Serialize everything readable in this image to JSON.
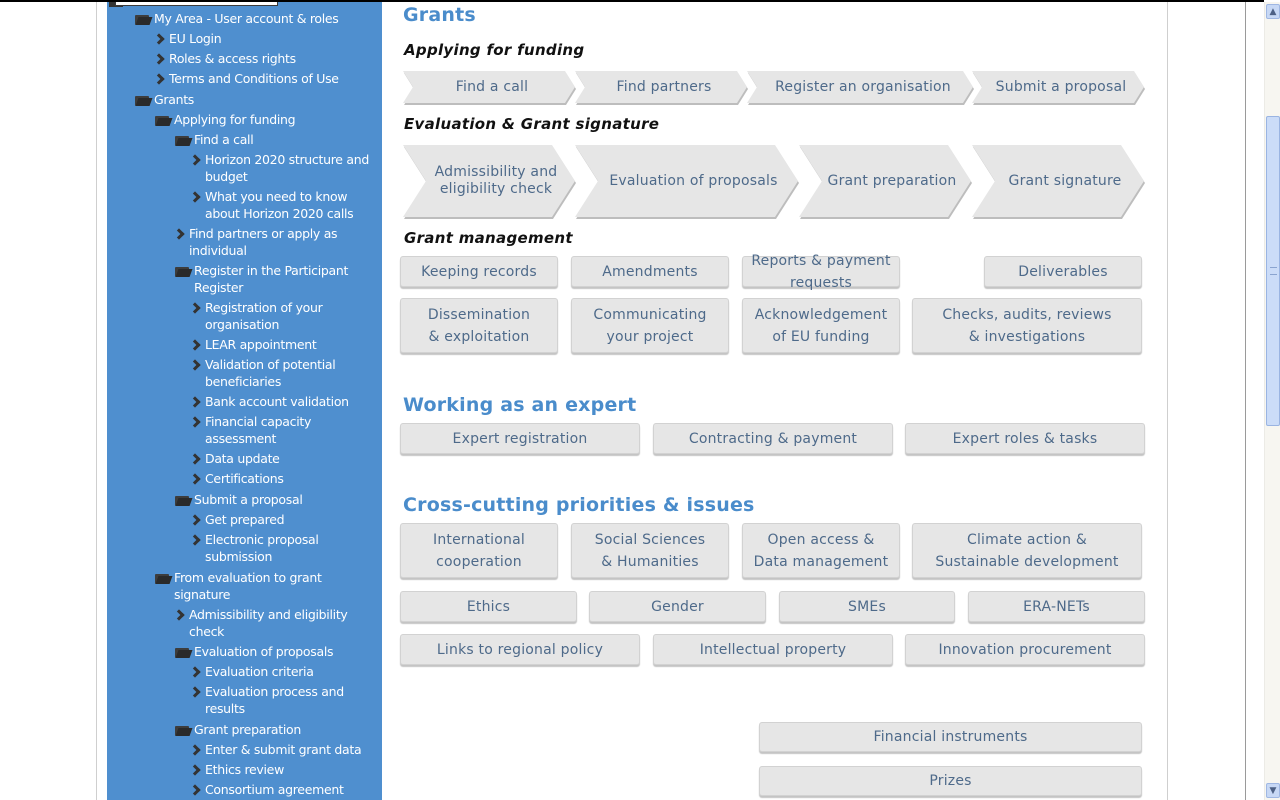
{
  "sidebar": {
    "items": [
      {
        "label": "My Area - User account & roles",
        "icon": "folder-open-icon",
        "level": 0
      },
      {
        "label": "EU Login",
        "icon": "chevron-right-icon",
        "level": 1
      },
      {
        "label": "Roles & access rights",
        "icon": "chevron-right-icon",
        "level": 1
      },
      {
        "label": "Terms and Conditions of Use",
        "icon": "chevron-right-icon",
        "level": 1
      },
      {
        "label": "Grants",
        "icon": "folder-open-icon",
        "level": 0
      },
      {
        "label": "Applying for funding",
        "icon": "folder-open-icon",
        "level": 1
      },
      {
        "label": "Find a call",
        "icon": "folder-open-icon",
        "level": 2
      },
      {
        "label": "Horizon 2020 structure and budget",
        "icon": "chevron-right-icon",
        "level": 3
      },
      {
        "label": "What you need to know about Horizon 2020 calls",
        "icon": "chevron-right-icon",
        "level": 3
      },
      {
        "label": "Find partners or apply as individual",
        "icon": "chevron-right-icon",
        "level": 2
      },
      {
        "label": "Register in the Participant Register",
        "icon": "folder-open-icon",
        "level": 2
      },
      {
        "label": "Registration of your organisation",
        "icon": "chevron-right-icon",
        "level": 3
      },
      {
        "label": "LEAR appointment",
        "icon": "chevron-right-icon",
        "level": 3
      },
      {
        "label": "Validation of potential beneficiaries",
        "icon": "chevron-right-icon",
        "level": 3
      },
      {
        "label": "Bank account validation",
        "icon": "chevron-right-icon",
        "level": 3
      },
      {
        "label": "Financial capacity assessment",
        "icon": "chevron-right-icon",
        "level": 3
      },
      {
        "label": "Data update",
        "icon": "chevron-right-icon",
        "level": 3
      },
      {
        "label": "Certifications",
        "icon": "chevron-right-icon",
        "level": 3
      },
      {
        "label": "Submit a proposal",
        "icon": "folder-open-icon",
        "level": 2
      },
      {
        "label": "Get prepared",
        "icon": "chevron-right-icon",
        "level": 3
      },
      {
        "label": "Electronic proposal submission",
        "icon": "chevron-right-icon",
        "level": 3
      },
      {
        "label": "From evaluation to grant signature",
        "icon": "folder-open-icon",
        "level": 1
      },
      {
        "label": "Admissibility and eligibility check",
        "icon": "chevron-right-icon",
        "level": 2
      },
      {
        "label": "Evaluation of proposals",
        "icon": "folder-open-icon",
        "level": 2
      },
      {
        "label": "Evaluation criteria",
        "icon": "chevron-right-icon",
        "level": 3
      },
      {
        "label": "Evaluation process and results",
        "icon": "chevron-right-icon",
        "level": 3
      },
      {
        "label": "Grant preparation",
        "icon": "folder-open-icon",
        "level": 2
      },
      {
        "label": "Enter & submit grant data",
        "icon": "chevron-right-icon",
        "level": 3
      },
      {
        "label": "Ethics review",
        "icon": "chevron-right-icon",
        "level": 3
      },
      {
        "label": "Consortium agreement",
        "icon": "chevron-right-icon",
        "level": 3
      }
    ]
  },
  "main": {
    "grants_title": "Grants",
    "applying": {
      "title": "Applying for funding",
      "steps": [
        "Find a call",
        "Find partners",
        "Register an organisation",
        "Submit a proposal"
      ]
    },
    "evaluation": {
      "title": "Evaluation & Grant signature",
      "steps": [
        "Admissibility and\neligibility check",
        "Evaluation of proposals",
        "Grant preparation",
        "Grant signature"
      ]
    },
    "management": {
      "title": "Grant management",
      "row1": [
        "Keeping records",
        "Amendments",
        "Reports & payment requests",
        "Deliverables"
      ],
      "row2": [
        "Dissemination\n& exploitation",
        "Communicating\nyour project",
        "Acknowledgement\nof EU funding",
        "Checks, audits, reviews\n& investigations"
      ]
    },
    "expert": {
      "title": "Working as an expert",
      "buttons": [
        "Expert registration",
        "Contracting & payment",
        "Expert roles & tasks"
      ]
    },
    "cross_cutting": {
      "title": "Cross-cutting priorities & issues",
      "row1": [
        "International\ncooperation",
        "Social Sciences\n& Humanities",
        "Open access &\nData management",
        "Climate action &\nSustainable development"
      ],
      "row2": [
        "Ethics",
        "Gender",
        "SMEs",
        "ERA-NETs"
      ],
      "row3": [
        "Links to regional policy",
        "Intellectual property",
        "Innovation procurement"
      ]
    },
    "extra": [
      "Financial instruments",
      "Prizes"
    ]
  },
  "scrollbar": {
    "up_icon": "▲",
    "down_icon": "▼"
  }
}
